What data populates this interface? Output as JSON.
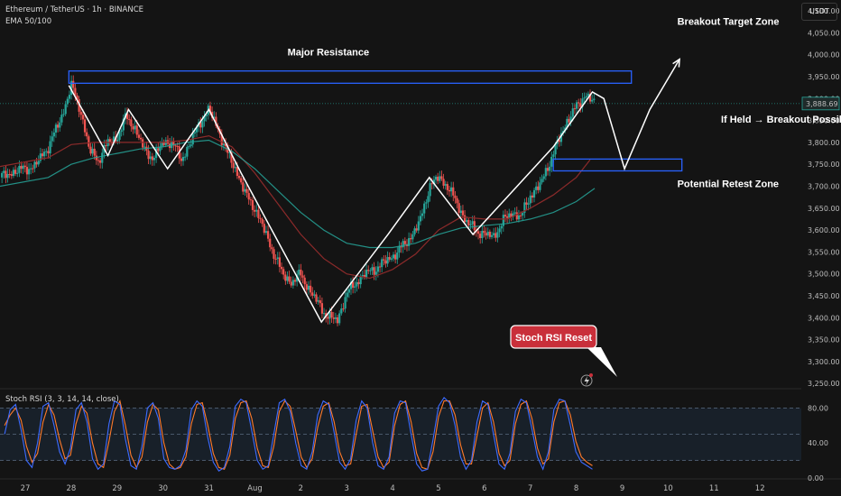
{
  "header": {
    "symbol_line": "Ethereum / TetherUS · 1h · BINANCE",
    "indicator_line": "EMA 50/100",
    "currency_button": "USDT"
  },
  "price_tag": "3,888.69",
  "stoch": {
    "title": "Stoch RSI (3, 3, 14, 14, close)",
    "ticks": [
      "80.00",
      "40.00",
      "0.00"
    ]
  },
  "colors": {
    "background": "#141414",
    "up": "#26a69a",
    "down": "#ef5350",
    "ema_fast": "#8b2a2a",
    "ema_slow": "#26a69a",
    "zone": "#2962ff",
    "stoch_k": "#3d6bff",
    "stoch_d": "#ff7a2a",
    "badge": "#c92f3a",
    "price_tag": "#1f2a2a"
  },
  "chart_data": {
    "type": "line",
    "y_ticks": [
      "4,100.00",
      "4,050.00",
      "4,000.00",
      "3,950.00",
      "3,900.00",
      "3,850.00",
      "3,800.00",
      "3,750.00",
      "3,700.00",
      "3,650.00",
      "3,600.00",
      "3,550.00",
      "3,500.00",
      "3,450.00",
      "3,400.00",
      "3,350.00",
      "3,300.00",
      "3,250.00"
    ],
    "ylim": [
      3240,
      4125
    ],
    "x_ticks": [
      "27",
      "28",
      "29",
      "30",
      "31",
      "Aug",
      "2",
      "3",
      "4",
      "5",
      "6",
      "7",
      "8",
      "9",
      "10",
      "11",
      "12"
    ],
    "x_tick_days": [
      0,
      1,
      2,
      3,
      4,
      5,
      6,
      7,
      8,
      9,
      10,
      11,
      12,
      13,
      14,
      15,
      16
    ],
    "xlim": [
      -0.55,
      16.9
    ],
    "price_path": [
      [
        -0.55,
        3720
      ],
      [
        -0.2,
        3735
      ],
      [
        0.2,
        3745
      ],
      [
        0.5,
        3790
      ],
      [
        0.8,
        3860
      ],
      [
        1.0,
        3930
      ],
      [
        1.2,
        3875
      ],
      [
        1.4,
        3780
      ],
      [
        1.6,
        3760
      ],
      [
        1.8,
        3800
      ],
      [
        2.0,
        3810
      ],
      [
        2.2,
        3860
      ],
      [
        2.4,
        3830
      ],
      [
        2.6,
        3780
      ],
      [
        2.8,
        3765
      ],
      [
        3.0,
        3800
      ],
      [
        3.2,
        3800
      ],
      [
        3.4,
        3760
      ],
      [
        3.6,
        3800
      ],
      [
        3.8,
        3845
      ],
      [
        4.0,
        3875
      ],
      [
        4.2,
        3830
      ],
      [
        4.4,
        3775
      ],
      [
        4.6,
        3735
      ],
      [
        4.8,
        3680
      ],
      [
        5.0,
        3650
      ],
      [
        5.2,
        3600
      ],
      [
        5.4,
        3550
      ],
      [
        5.6,
        3500
      ],
      [
        5.8,
        3480
      ],
      [
        6.0,
        3500
      ],
      [
        6.2,
        3460
      ],
      [
        6.4,
        3430
      ],
      [
        6.6,
        3400
      ],
      [
        6.8,
        3395
      ],
      [
        7.0,
        3455
      ],
      [
        7.2,
        3480
      ],
      [
        7.4,
        3500
      ],
      [
        7.6,
        3510
      ],
      [
        7.8,
        3525
      ],
      [
        8.0,
        3540
      ],
      [
        8.2,
        3560
      ],
      [
        8.4,
        3585
      ],
      [
        8.6,
        3620
      ],
      [
        8.8,
        3700
      ],
      [
        9.0,
        3720
      ],
      [
        9.2,
        3700
      ],
      [
        9.4,
        3660
      ],
      [
        9.6,
        3620
      ],
      [
        9.8,
        3600
      ],
      [
        10.0,
        3590
      ],
      [
        10.2,
        3585
      ],
      [
        10.4,
        3620
      ],
      [
        10.6,
        3640
      ],
      [
        10.8,
        3630
      ],
      [
        11.0,
        3680
      ],
      [
        11.2,
        3700
      ],
      [
        11.4,
        3750
      ],
      [
        11.6,
        3800
      ],
      [
        11.8,
        3850
      ],
      [
        12.0,
        3880
      ],
      [
        12.2,
        3910
      ],
      [
        12.4,
        3888
      ]
    ],
    "ema_fast": [
      [
        -0.55,
        3745
      ],
      [
        0.5,
        3765
      ],
      [
        1.0,
        3795
      ],
      [
        1.5,
        3800
      ],
      [
        2.0,
        3800
      ],
      [
        2.5,
        3800
      ],
      [
        3.0,
        3800
      ],
      [
        3.5,
        3805
      ],
      [
        4.0,
        3815
      ],
      [
        4.5,
        3790
      ],
      [
        5.0,
        3730
      ],
      [
        5.5,
        3660
      ],
      [
        6.0,
        3590
      ],
      [
        6.5,
        3535
      ],
      [
        7.0,
        3500
      ],
      [
        7.5,
        3490
      ],
      [
        8.0,
        3510
      ],
      [
        8.5,
        3545
      ],
      [
        9.0,
        3600
      ],
      [
        9.5,
        3630
      ],
      [
        10.0,
        3625
      ],
      [
        10.5,
        3625
      ],
      [
        11.0,
        3650
      ],
      [
        11.5,
        3680
      ],
      [
        12.0,
        3720
      ],
      [
        12.3,
        3760
      ]
    ],
    "ema_slow": [
      [
        -0.55,
        3700
      ],
      [
        0.5,
        3720
      ],
      [
        1.0,
        3750
      ],
      [
        1.5,
        3765
      ],
      [
        2.0,
        3775
      ],
      [
        2.5,
        3785
      ],
      [
        3.0,
        3790
      ],
      [
        3.5,
        3800
      ],
      [
        4.0,
        3805
      ],
      [
        4.5,
        3780
      ],
      [
        5.0,
        3740
      ],
      [
        5.5,
        3690
      ],
      [
        6.0,
        3640
      ],
      [
        6.5,
        3600
      ],
      [
        7.0,
        3570
      ],
      [
        7.5,
        3560
      ],
      [
        8.0,
        3560
      ],
      [
        8.5,
        3570
      ],
      [
        9.0,
        3590
      ],
      [
        9.5,
        3605
      ],
      [
        10.0,
        3610
      ],
      [
        10.5,
        3615
      ],
      [
        11.0,
        3625
      ],
      [
        11.5,
        3640
      ],
      [
        12.0,
        3665
      ],
      [
        12.4,
        3695
      ]
    ],
    "pattern_path": [
      [
        0.95,
        3930
      ],
      [
        1.8,
        3770
      ],
      [
        2.25,
        3875
      ],
      [
        3.1,
        3740
      ],
      [
        4.0,
        3875
      ],
      [
        4.7,
        3730
      ],
      [
        6.45,
        3390
      ],
      [
        7.9,
        3590
      ],
      [
        8.8,
        3720
      ],
      [
        9.75,
        3590
      ],
      [
        11.5,
        3790
      ],
      [
        12.35,
        3915
      ],
      [
        12.6,
        3900
      ],
      [
        13.05,
        3740
      ],
      [
        13.6,
        3875
      ],
      [
        14.25,
        3990
      ]
    ],
    "resistance_zone": {
      "x0": 0.95,
      "x1": 13.2,
      "y0": 3935,
      "y1": 3963
    },
    "retest_zone": {
      "x0": 11.5,
      "x1": 14.3,
      "y0": 3735,
      "y1": 3762
    },
    "annotations": [
      {
        "text": "Major Resistance",
        "x": 6.6,
        "y": 3998
      },
      {
        "text": "Breakout Target Zone",
        "x": 14.2,
        "y": 4068
      },
      {
        "text": "If Held → Breakout Possible",
        "x": 15.15,
        "y": 3845
      },
      {
        "text": "Potential Retest Zone",
        "x": 14.2,
        "y": 3698
      }
    ],
    "badge_text": "Stoch RSI Reset"
  },
  "stoch_data": {
    "ylim": [
      0,
      100
    ],
    "k": [
      50,
      78,
      84,
      55,
      20,
      12,
      40,
      82,
      86,
      60,
      30,
      16,
      34,
      78,
      86,
      64,
      22,
      10,
      16,
      62,
      88,
      84,
      44,
      14,
      10,
      36,
      80,
      86,
      68,
      22,
      12,
      10,
      14,
      32,
      78,
      88,
      82,
      46,
      18,
      8,
      12,
      36,
      82,
      90,
      86,
      54,
      20,
      10,
      14,
      50,
      86,
      90,
      76,
      40,
      14,
      10,
      30,
      72,
      88,
      84,
      52,
      18,
      10,
      22,
      66,
      88,
      80,
      40,
      14,
      10,
      24,
      74,
      88,
      86,
      50,
      16,
      8,
      10,
      44,
      82,
      92,
      86,
      60,
      24,
      10,
      20,
      64,
      88,
      84,
      50,
      16,
      10,
      28,
      76,
      90,
      86,
      56,
      24,
      10,
      30,
      78,
      90,
      88,
      60,
      30,
      18,
      14,
      10
    ],
    "d": [
      60,
      72,
      80,
      66,
      36,
      18,
      28,
      64,
      84,
      72,
      44,
      22,
      26,
      62,
      82,
      74,
      40,
      16,
      12,
      42,
      76,
      88,
      60,
      26,
      12,
      24,
      64,
      84,
      78,
      40,
      16,
      10,
      12,
      24,
      62,
      84,
      86,
      60,
      28,
      12,
      10,
      26,
      68,
      86,
      88,
      68,
      34,
      14,
      12,
      36,
      76,
      88,
      82,
      54,
      24,
      12,
      22,
      58,
      82,
      86,
      64,
      30,
      14,
      16,
      50,
      82,
      84,
      54,
      24,
      12,
      18,
      60,
      84,
      88,
      64,
      28,
      12,
      10,
      30,
      70,
      88,
      88,
      72,
      38,
      16,
      16,
      48,
      80,
      86,
      64,
      28,
      14,
      20,
      62,
      84,
      88,
      68,
      34,
      16,
      22,
      64,
      86,
      88,
      72,
      42,
      24,
      18,
      14
    ]
  }
}
